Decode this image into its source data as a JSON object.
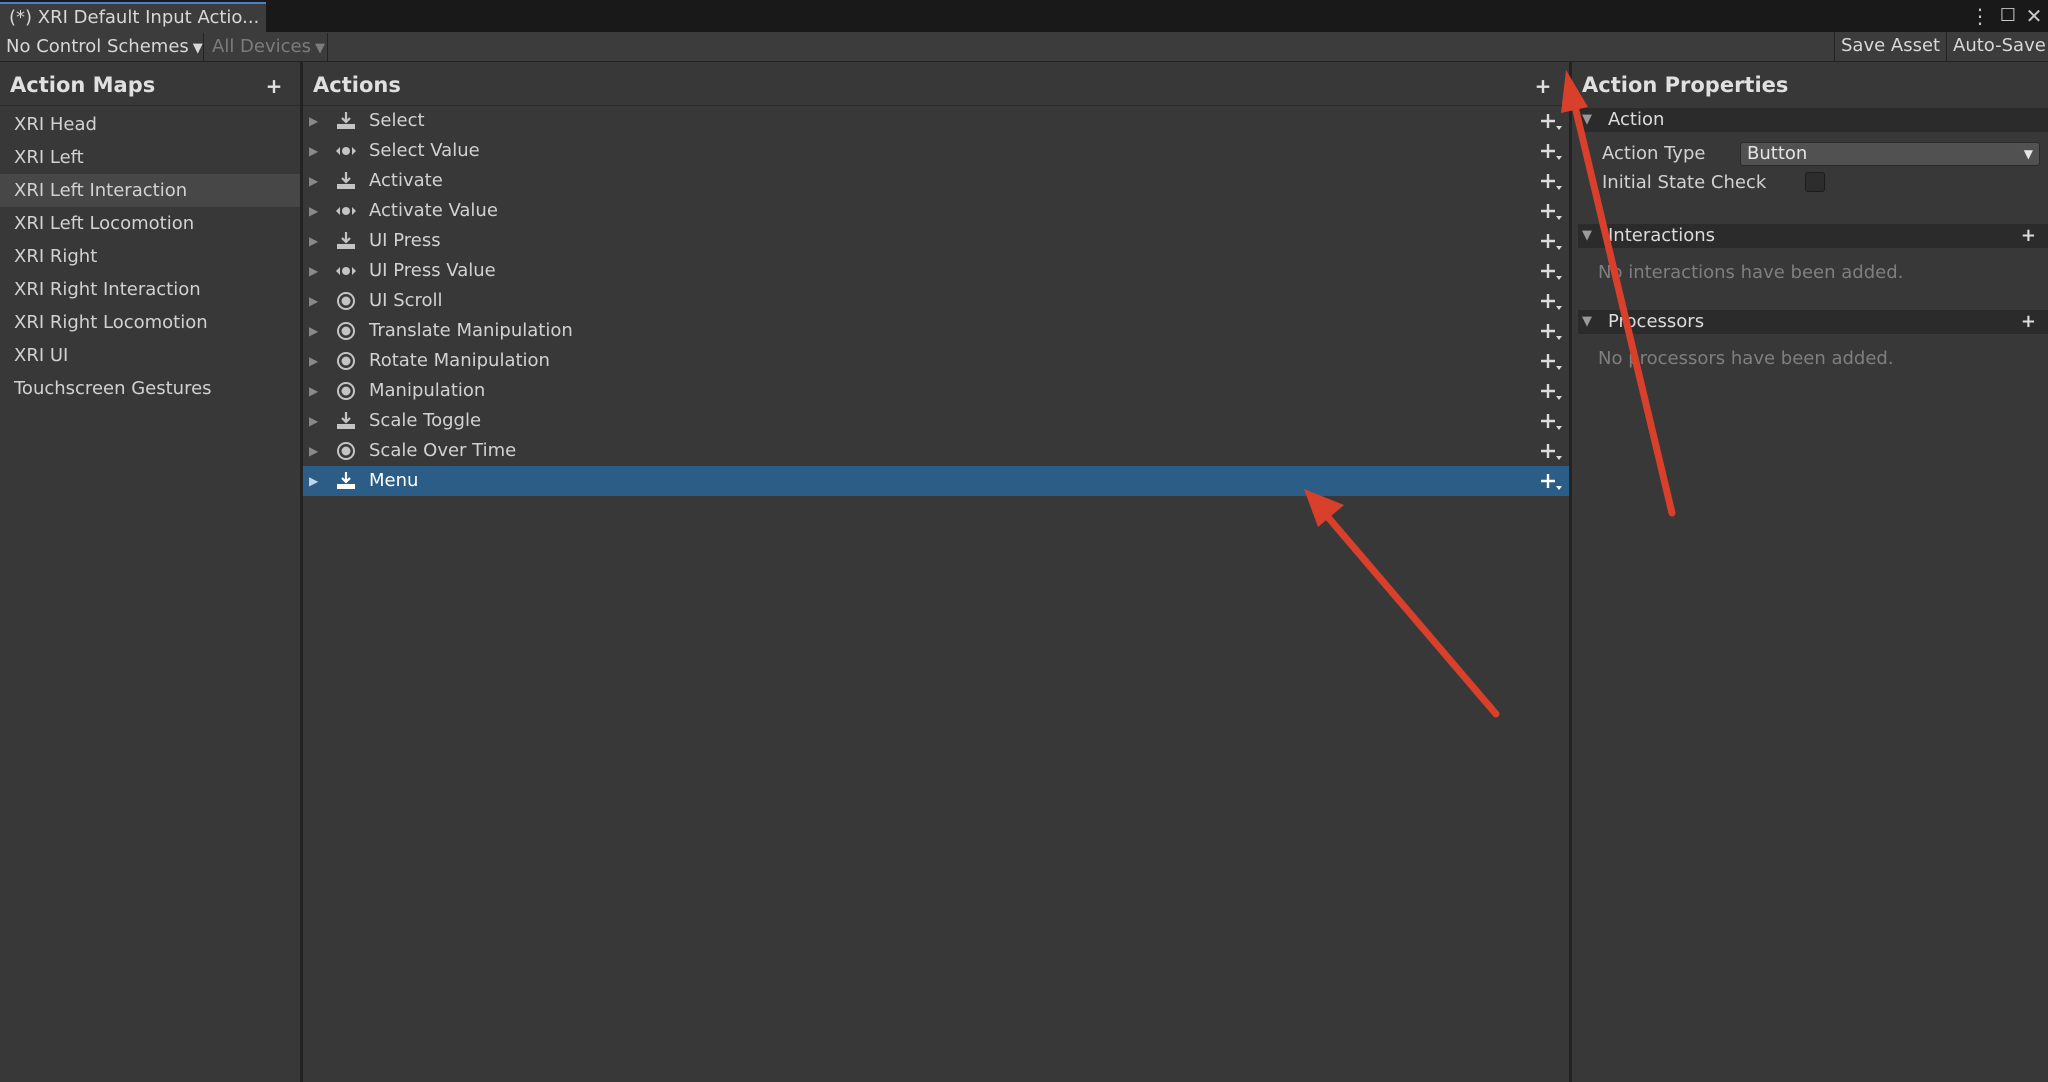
{
  "window": {
    "tab_title": "(*) XRI Default Input Actio...",
    "more_icon": "⋮",
    "maximize_icon": "☐",
    "close_icon": "✕"
  },
  "toolbar": {
    "control_schemes": "No Control Schemes",
    "devices": "All Devices",
    "save_asset": "Save Asset",
    "auto_save": "Auto-Save"
  },
  "action_maps": {
    "title": "Action Maps",
    "add_symbol": "+",
    "items": [
      "XRI Head",
      "XRI Left",
      "XRI Left Interaction",
      "XRI Left Locomotion",
      "XRI Right",
      "XRI Right Interaction",
      "XRI Right Locomotion",
      "XRI UI",
      "Touchscreen Gestures"
    ],
    "selected": "XRI Left Interaction"
  },
  "actions": {
    "title": "Actions",
    "add_symbol": "+",
    "items": [
      {
        "label": "Select",
        "icon": "button-icon"
      },
      {
        "label": "Select Value",
        "icon": "value-icon"
      },
      {
        "label": "Activate",
        "icon": "button-icon"
      },
      {
        "label": "Activate Value",
        "icon": "value-icon"
      },
      {
        "label": "UI Press",
        "icon": "button-icon"
      },
      {
        "label": "UI Press Value",
        "icon": "value-icon"
      },
      {
        "label": "UI Scroll",
        "icon": "passthrough-icon"
      },
      {
        "label": "Translate Manipulation",
        "icon": "passthrough-icon"
      },
      {
        "label": "Rotate Manipulation",
        "icon": "passthrough-icon"
      },
      {
        "label": "Manipulation",
        "icon": "passthrough-icon"
      },
      {
        "label": "Scale Toggle",
        "icon": "button-icon"
      },
      {
        "label": "Scale Over Time",
        "icon": "passthrough-icon"
      },
      {
        "label": "Menu",
        "icon": "button-icon"
      }
    ],
    "selected": "Menu"
  },
  "properties": {
    "title": "Action Properties",
    "action_section": "Action",
    "action_type_label": "Action Type",
    "action_type_value": "Button",
    "initial_state_label": "Initial State Check",
    "initial_state_checked": false,
    "interactions_section": "Interactions",
    "interactions_empty": "No interactions have been added.",
    "processors_section": "Processors",
    "processors_empty": "No processors have been added.",
    "add_symbol": "+"
  },
  "annotation_color": "#d9402b"
}
